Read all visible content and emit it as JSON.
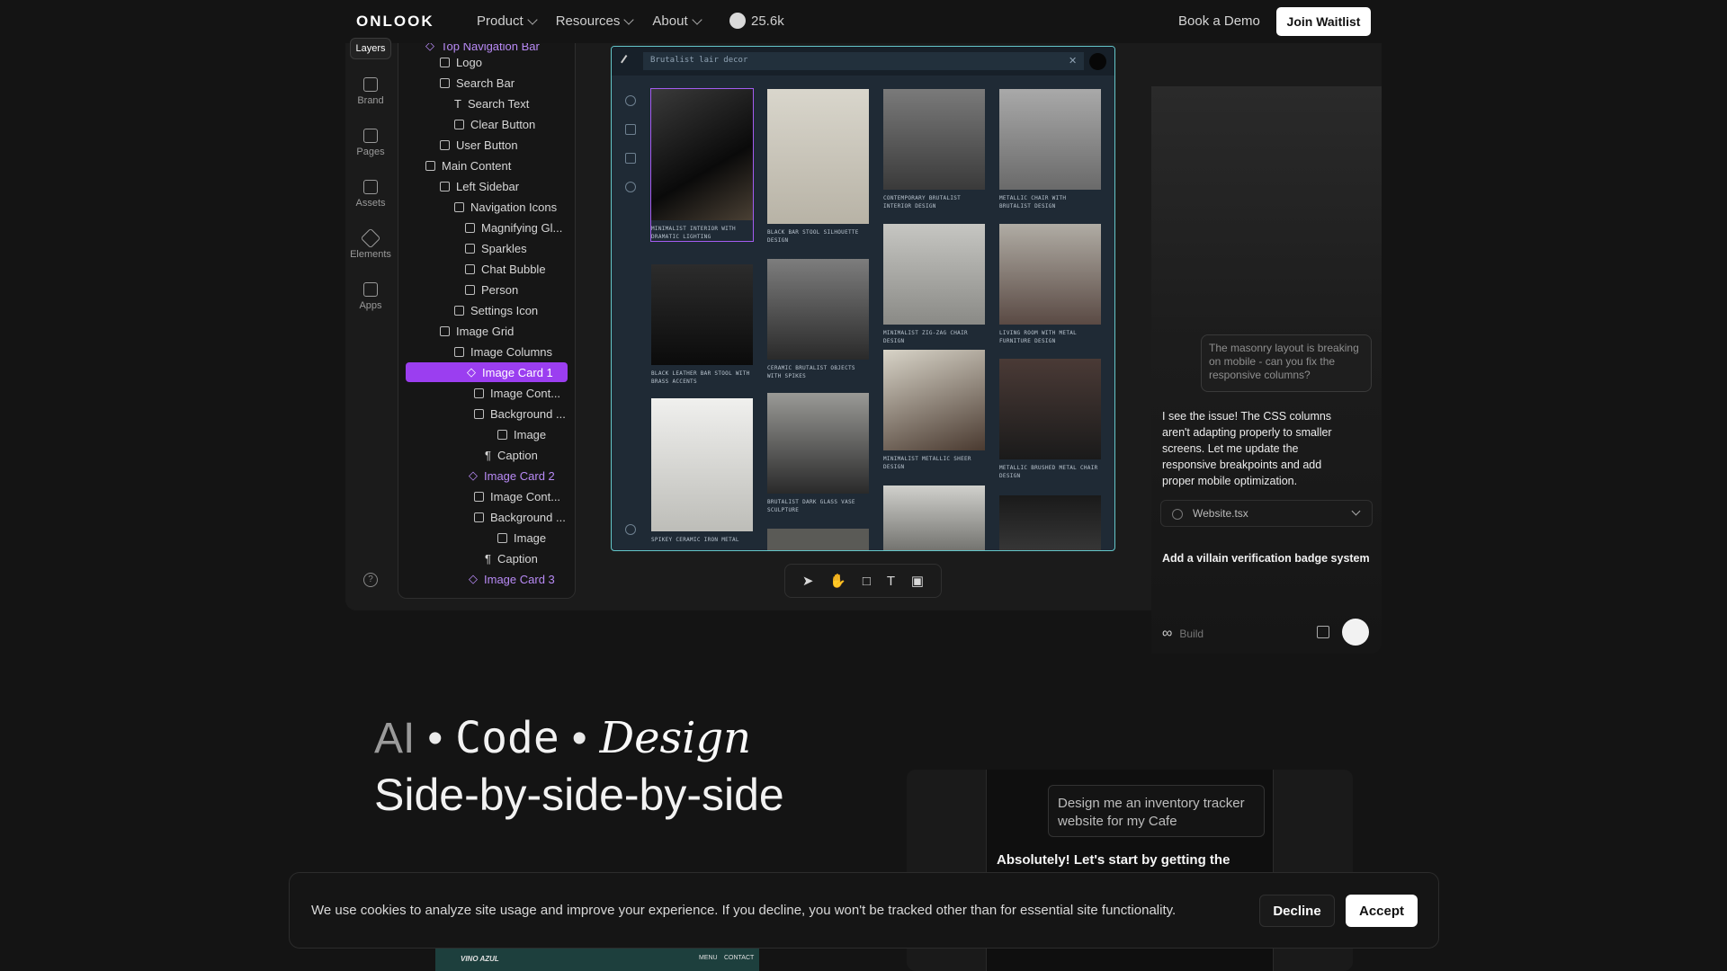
{
  "nav": {
    "logo": "ONLOOK",
    "menu": [
      "Product",
      "Resources",
      "About"
    ],
    "github_stars": "25.6k",
    "book_demo": "Book a Demo",
    "join_waitlist": "Join Waitlist"
  },
  "rail": {
    "layers": "Layers",
    "items": [
      "Brand",
      "Pages",
      "Assets",
      "Elements",
      "Apps"
    ]
  },
  "tree": {
    "items": [
      "Top Navigation Bar",
      "Logo",
      "Search Bar",
      "Search Text",
      "Clear Button",
      "User Button",
      "Main Content",
      "Left Sidebar",
      "Navigation Icons",
      "Magnifying Gl...",
      "Sparkles",
      "Chat Bubble",
      "Person",
      "Settings Icon",
      "Image Grid",
      "Image Columns",
      "Image Card 1",
      "Image Cont...",
      "Background ...",
      "Image",
      "Caption",
      "Image Card 2",
      "Image Cont...",
      "Background ...",
      "Image",
      "Caption",
      "Image Card 3"
    ]
  },
  "canvas": {
    "url": "Brutalist lair decor",
    "captions": [
      "MINIMALIST INTERIOR WITH DRAMATIC LIGHTING",
      "BLACK BAR STOOL SILHOUETTE DESIGN",
      "CONTEMPORARY BRUTALIST INTERIOR DESIGN",
      "METALLIC CHAIR WITH BRUTALIST DESIGN",
      "BLACK LEATHER BAR STOOL WITH BRASS ACCENTS",
      "CERAMIC BRUTALIST OBJECTS WITH SPIKES",
      "MINIMALIST ZIG-ZAG CHAIR DESIGN",
      "LIVING ROOM WITH METAL FURNITURE DESIGN",
      "SPIKEY CERAMIC IRON METAL",
      "BRUTALIST DARK GLASS VASE SCULPTURE",
      "MINIMALIST METALLIC SHEER DESIGN",
      "METALLIC BRUSHED METAL CHAIR DESIGN"
    ]
  },
  "chat": {
    "user_msg": "The masonry layout is breaking on mobile - can you fix the responsive columns?",
    "ai_msg": "I see the issue! The CSS columns aren't adapting properly to smaller screens. Let me update the responsive breakpoints and add proper mobile optimization.",
    "file": "Website.tsx",
    "input": "Add a villain verification badge system",
    "build": "Build"
  },
  "hero": {
    "ai": "AI",
    "sep": "•",
    "code": "Code",
    "design": "Design",
    "subtitle": "Side-by-side-by-side"
  },
  "demo": {
    "prompt": "Design me an inventory tracker website for my Cafe",
    "response": "Absolutely! Let's start by getting the",
    "site_title": "VINO AZUL",
    "site_menu": "MENU",
    "site_contact": "CONTACT"
  },
  "cookie": {
    "text": "We use cookies to analyze site usage and improve your experience. If you decline, you won't be tracked other than for essential site functionality.",
    "decline": "Decline",
    "accept": "Accept"
  }
}
